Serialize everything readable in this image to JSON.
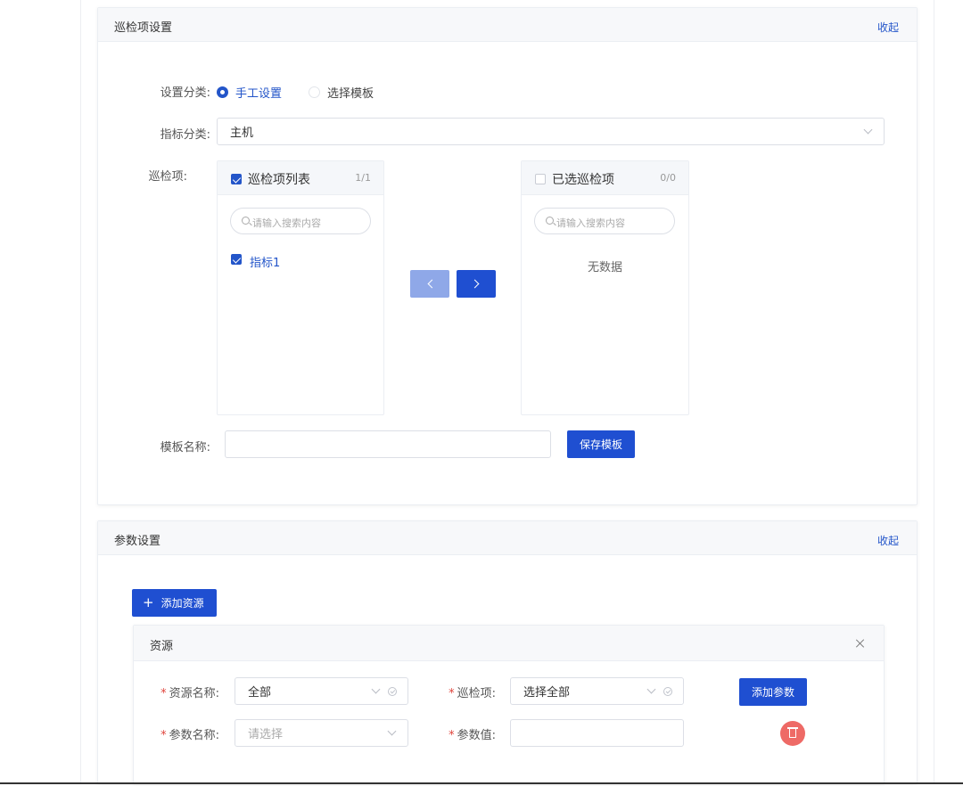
{
  "inspection_section": {
    "title": "巡检项设置",
    "collapse_label": "收起",
    "setting_type_label": "设置分类:",
    "radio_manual": "手工设置",
    "radio_template": "选择模板",
    "metric_category_label": "指标分类:",
    "metric_category_value": "主机",
    "items_label": "巡检项:",
    "left_list": {
      "title": "巡检项列表",
      "count": "1/1",
      "search_placeholder": "请输入搜索内容",
      "items": [
        "指标1"
      ]
    },
    "right_list": {
      "title": "已选巡检项",
      "count": "0/0",
      "search_placeholder": "请输入搜索内容",
      "empty_text": "无数据"
    },
    "template_name_label": "模板名称:",
    "template_name_value": "",
    "save_template_button": "保存模板"
  },
  "param_section": {
    "title": "参数设置",
    "collapse_label": "收起",
    "add_resource_button": "添加资源",
    "resource_card": {
      "title": "资源",
      "resource_name_label": "资源名称:",
      "resource_name_value": "全部",
      "inspection_item_label": "巡检项:",
      "inspection_item_value": "选择全部",
      "add_param_button": "添加参数",
      "param_name_label": "参数名称:",
      "param_name_placeholder": "请选择",
      "param_value_label": "参数值:",
      "param_value_value": "",
      "required_mark": "*"
    }
  },
  "colors": {
    "primary": "#1f4fd1",
    "primary_disabled": "#8fa8e8",
    "danger": "#ee6a66",
    "link": "#2355c9"
  },
  "icons": [
    "search-icon",
    "chevron-down-icon",
    "chevron-left-icon",
    "chevron-right-icon",
    "plus-icon",
    "close-icon",
    "trash-icon",
    "check-circle-icon"
  ]
}
